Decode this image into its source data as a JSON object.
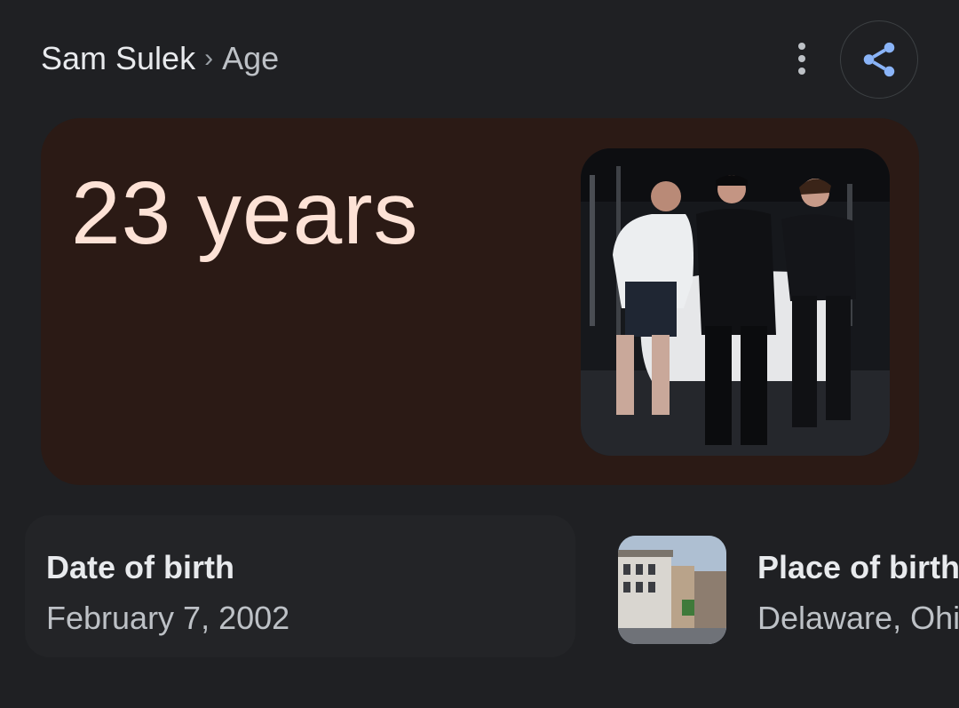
{
  "breadcrumb": {
    "root": "Sam Sulek",
    "separator": "›",
    "leaf": "Age"
  },
  "answer": {
    "value": "23 years"
  },
  "date_of_birth": {
    "label": "Date of birth",
    "value": "February 7, 2002"
  },
  "place_of_birth": {
    "label": "Place of birth",
    "value": "Delaware, Ohio"
  },
  "icons": {
    "more": "more-vert-icon",
    "share": "share-icon"
  },
  "colors": {
    "accent": "#8ab4f8",
    "card_bg": "#2b1a15",
    "age_text": "#fde2d6"
  }
}
